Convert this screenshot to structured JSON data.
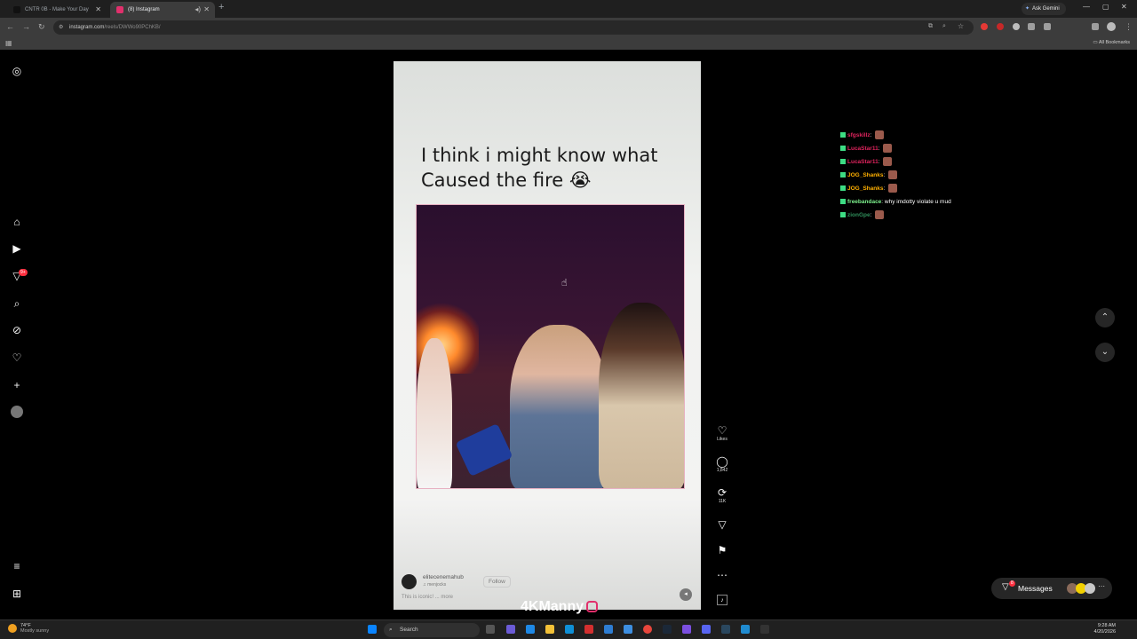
{
  "browser": {
    "tabs": [
      {
        "title": "CNTR 0B - Make Your Day",
        "active": false
      },
      {
        "title": "(8) Instagram",
        "active": true
      }
    ],
    "url_host": "instagram.com",
    "url_path": "/reels/DWWo90PChKB/",
    "ask_gemini": "Ask Gemini",
    "all_bookmarks": "All Bookmarks"
  },
  "sidebar": {
    "notification_count": "9+"
  },
  "reel": {
    "caption_line1": "I think i might know what",
    "caption_line2": "Caused the fire 😭",
    "author": "elitecenemahub",
    "author_sub": "♫ menjocks",
    "follow_label": "Follow",
    "description": "This is iconic! ... more",
    "actions": {
      "likes_label": "Likes",
      "comments_count": "1,842",
      "reposts_count": "11K"
    }
  },
  "watermark": "4KManny",
  "chat": [
    {
      "user": "sfgskillz",
      "color": "#e0245e",
      "text": ""
    },
    {
      "user": "LucaStar11",
      "color": "#e0245e",
      "text": ""
    },
    {
      "user": "LucaStar11",
      "color": "#e0245e",
      "text": ""
    },
    {
      "user": "JOG_Shanks",
      "color": "#ffb000",
      "text": ""
    },
    {
      "user": "JOG_Shanks",
      "color": "#ffb000",
      "text": ""
    },
    {
      "user": "freebandace",
      "color": "#7cf08c",
      "text": "why imdotty violate u mud"
    },
    {
      "user": "zionGpe",
      "color": "#2f8f5b",
      "text": ""
    }
  ],
  "messages": {
    "label": "Messages",
    "count": "8"
  },
  "taskbar": {
    "temp": "74°F",
    "weather": "Mostly sunny",
    "search_placeholder": "Search",
    "time": "9:28 AM",
    "date": "4/20/2026"
  }
}
